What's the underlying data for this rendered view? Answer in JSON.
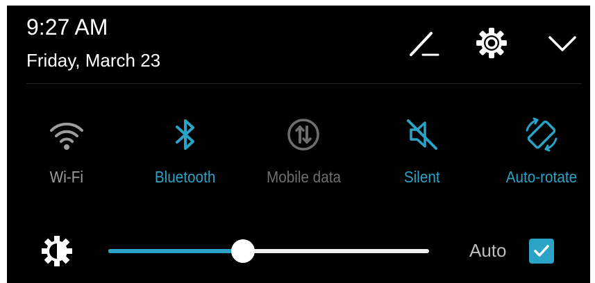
{
  "header": {
    "time": "9:27 AM",
    "date": "Friday, March 23",
    "edit_icon": "pencil-edit-icon",
    "settings_icon": "gear-icon",
    "collapse_icon": "chevron-down-icon"
  },
  "tiles": [
    {
      "label": "Wi-Fi",
      "icon": "wifi-icon",
      "active": false,
      "color": "#9e9e9e"
    },
    {
      "label": "Bluetooth",
      "icon": "bluetooth-icon",
      "active": true,
      "color": "#2ba3c7"
    },
    {
      "label": "Mobile data",
      "icon": "mobile-data-icon",
      "active": false,
      "color": "#6e6e6e"
    },
    {
      "label": "Silent",
      "icon": "silent-icon",
      "active": true,
      "color": "#2ba3c7"
    },
    {
      "label": "Auto-rotate",
      "icon": "auto-rotate-icon",
      "active": true,
      "color": "#2ba3c7"
    }
  ],
  "brightness": {
    "icon": "brightness-icon",
    "level": 0.42,
    "auto_label": "Auto",
    "auto_checked": true
  },
  "colors": {
    "accent": "#2ba3c7",
    "background": "#000000",
    "text_primary": "#ffffff",
    "inactive": "#9e9e9e",
    "disabled": "#6e6e6e"
  }
}
